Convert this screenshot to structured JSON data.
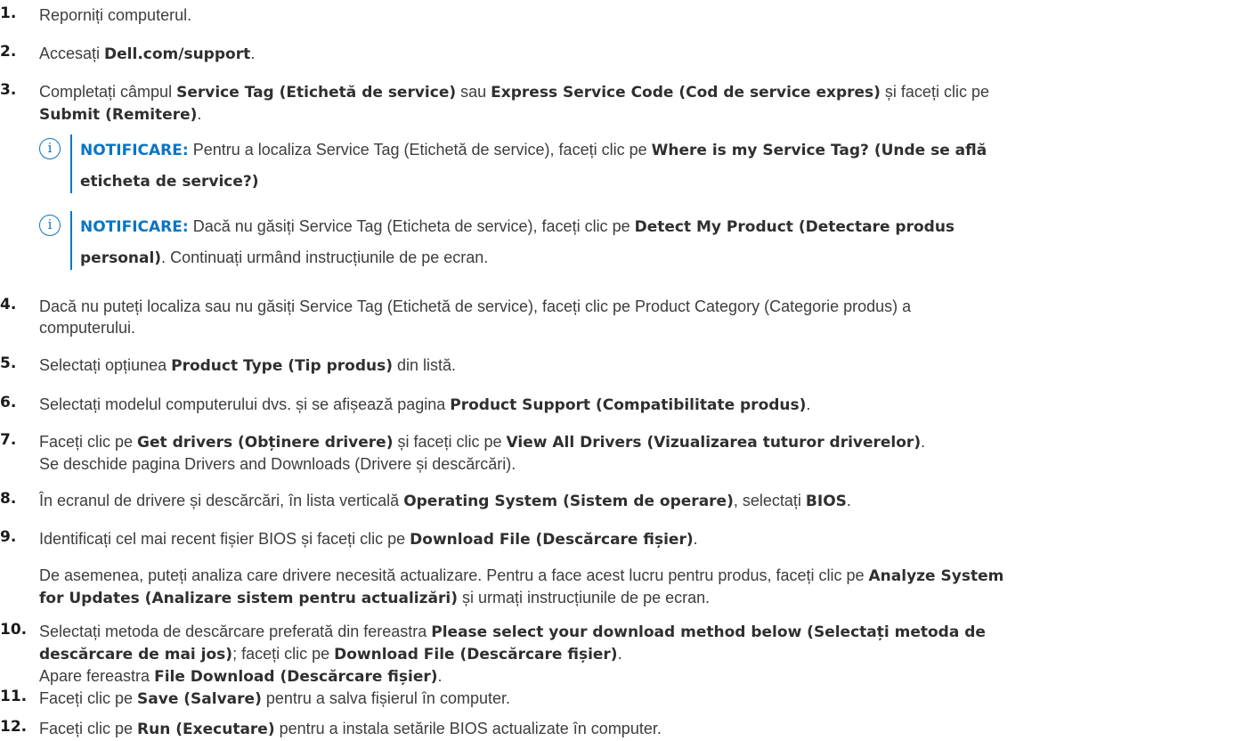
{
  "steps": [
    {
      "num": "1.",
      "text": "Reporniți computerul."
    },
    {
      "num": "2.",
      "a": "Accesați ",
      "b": "Dell.com/support",
      "c": "."
    },
    {
      "num": "3.",
      "a": "Completați câmpul ",
      "b": "Service Tag (Etichetă de service)",
      "c": " sau ",
      "d": "Express Service Code (Cod de service expres)",
      "e": " și faceți clic pe",
      "f": "Submit (Remitere)",
      "g": "."
    },
    {
      "num": "4.",
      "a": "Dacă nu puteți localiza sau nu găsiți Service Tag (Etichetă de service), faceți clic pe Product Category (Categorie produs) a",
      "b": "computerului."
    },
    {
      "num": "5.",
      "a": "Selectați opțiunea ",
      "b": "Product Type (Tip produs)",
      "c": " din listă."
    },
    {
      "num": "6.",
      "a": "Selectați modelul computerului dvs. și se afișează pagina ",
      "b": "Product Support (Compatibilitate produs)",
      "c": "."
    },
    {
      "num": "7.",
      "a": "Faceți clic pe ",
      "b": "Get drivers (Obținere drivere)",
      "c": " și faceți clic pe ",
      "d": "View All Drivers (Vizualizarea tuturor driverelor)",
      "e": ".",
      "f": "Se deschide pagina Drivers and Downloads (Drivere și descărcări)."
    },
    {
      "num": "8.",
      "a": "În ecranul de drivere și descărcări, în lista verticală ",
      "b": "Operating System (Sistem de operare)",
      "c": ", selectați ",
      "d": "BIOS",
      "e": "."
    },
    {
      "num": "9.",
      "a": "Identificați cel mai recent fișier BIOS și faceți clic pe ",
      "b": "Download File (Descărcare fișier)",
      "c": ".",
      "p1": "De asemenea, puteți analiza care drivere necesită actualizare. Pentru a face acest lucru pentru produs, faceți clic pe ",
      "p2": "Analyze System",
      "p3": "for Updates (Analizare sistem pentru actualizări)",
      "p4": " și urmați instrucțiunile de pe ecran."
    },
    {
      "num": "10.",
      "a": "Selectați metoda de descărcare preferată din fereastra ",
      "b": "Please select your download method below (Selectați metoda de",
      "c": "descărcare de mai jos)",
      "d": "; faceți clic pe ",
      "e": "Download File (Descărcare fișier)",
      "f": ".",
      "g": "Apare fereastra ",
      "h": "File Download (Descărcare fișier)",
      "i": "."
    },
    {
      "num": "11.",
      "a": "Faceți clic pe ",
      "b": "Save (Salvare)",
      "c": " pentru a salva fișierul în computer."
    },
    {
      "num": "12.",
      "a": "Faceți clic pe ",
      "b": "Run (Executare)",
      "c": " pentru a instala setările BIOS actualizate în computer."
    }
  ],
  "notes": [
    {
      "label": "NOTIFICARE:",
      "a": " Pentru a localiza Service Tag (Etichetă de service), faceți clic pe ",
      "b": "Where is my Service Tag? (Unde se află",
      "c": "eticheta de service?)"
    },
    {
      "label": "NOTIFICARE:",
      "a": " Dacă nu găsiți Service Tag (Eticheta de service), faceți clic pe ",
      "b": "Detect My Product (Detectare produs",
      "c": "personal)",
      "d": ". Continuați urmând instrucțiunile de pe ecran."
    }
  ],
  "icons": {
    "note_icon": "info-circle-icon",
    "accent": "#0b75c4"
  }
}
